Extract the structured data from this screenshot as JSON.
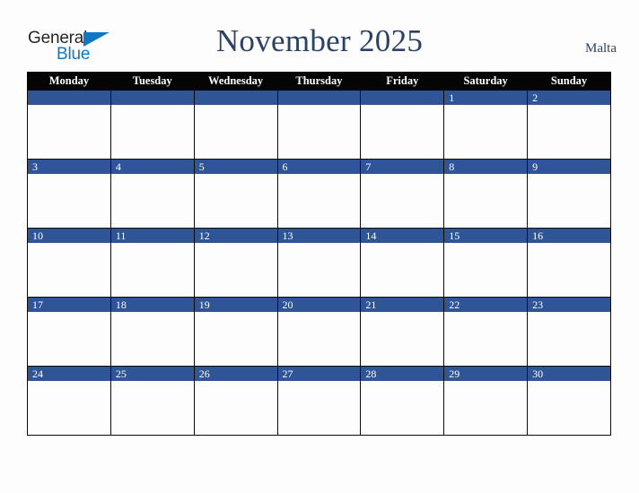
{
  "brand": {
    "name_part1": "General",
    "name_part2": "Blue",
    "triangle_icon": "triangle-icon",
    "accent_color": "#1177c4",
    "text_color": "#262626"
  },
  "header": {
    "title": "November 2025",
    "country": "Malta",
    "title_color": "#2b4264"
  },
  "calendar": {
    "month": "November",
    "year": "2025",
    "week_start": "Monday",
    "day_headers": [
      "Monday",
      "Tuesday",
      "Wednesday",
      "Thursday",
      "Friday",
      "Saturday",
      "Sunday"
    ],
    "header_bg": "#050505",
    "header_text_color": "#ffffff",
    "date_bar_color": "#2f5597",
    "date_text_color": "#ffffff",
    "cell_bg": "#fdfdfe",
    "border_color": "#0b0b0b",
    "weeks": [
      [
        "",
        "",
        "",
        "",
        "",
        "1",
        "2"
      ],
      [
        "3",
        "4",
        "5",
        "6",
        "7",
        "8",
        "9"
      ],
      [
        "10",
        "11",
        "12",
        "13",
        "14",
        "15",
        "16"
      ],
      [
        "17",
        "18",
        "19",
        "20",
        "21",
        "22",
        "23"
      ],
      [
        "24",
        "25",
        "26",
        "27",
        "28",
        "29",
        "30"
      ]
    ]
  }
}
